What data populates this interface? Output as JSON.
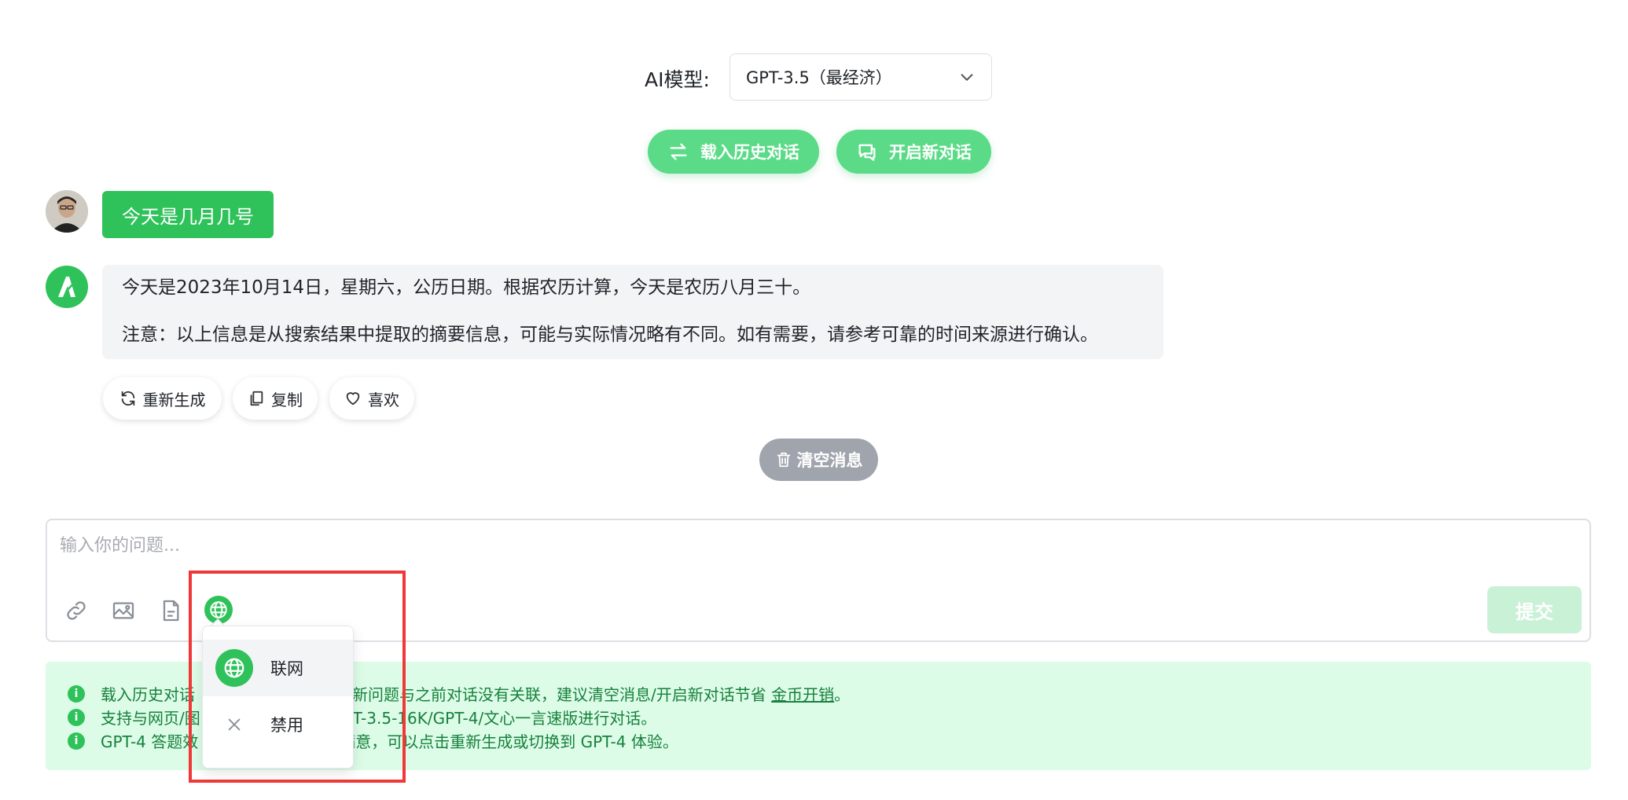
{
  "header": {
    "model_label": "AI模型:",
    "model_value": "GPT-3.5（最经济）",
    "history_button": "载入历史对话",
    "new_chat_button": "开启新对话"
  },
  "chat": {
    "user_message": "今天是几月几号",
    "bot_line_1": "今天是2023年10月14日，星期六，公历日期。根据农历计算，今天是农历八月三十。",
    "bot_line_2": "注意：以上信息是从搜索结果中提取的摘要信息，可能与实际情况略有不同。如有需要，请参考可靠的时间来源进行确认。"
  },
  "message_actions": {
    "regenerate": "重新生成",
    "copy": "复制",
    "like": "喜欢"
  },
  "clear_button": "清空消息",
  "input": {
    "placeholder": "输入你的问题...",
    "submit": "提交"
  },
  "dropdown": {
    "online": "联网",
    "disable": "禁用"
  },
  "info": {
    "line1_a": "载入历史对话",
    "line1_b": "换，如果新问题与之前对话没有关联，建议清空消息/开启新对话节省",
    "line1_link": "金币开销",
    "line1_end": "。",
    "line2_a": "支持与网页/图",
    "line2_b": "使用 GPT-3.5-16K/GPT-4/文心一言速版进行对话。",
    "line3_a": "GPT-4 答题效",
    "line3_b": "结果不满意，可以点击重新生成或切换到 GPT-4 体验。"
  },
  "colors": {
    "accent": "#2fc25b",
    "pill": "#5bdb87",
    "info_bg": "#dcfce7",
    "highlight": "#f03838"
  }
}
